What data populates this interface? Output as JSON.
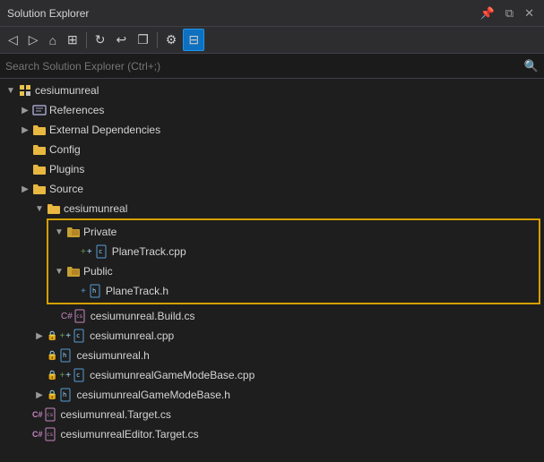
{
  "titleBar": {
    "title": "Solution Explorer",
    "icons": [
      "pin",
      "close-float",
      "close"
    ]
  },
  "toolbar": {
    "buttons": [
      {
        "name": "back",
        "label": "◀",
        "active": false
      },
      {
        "name": "forward",
        "label": "▶",
        "active": false
      },
      {
        "name": "home",
        "label": "⌂",
        "active": false
      },
      {
        "name": "properties",
        "label": "⊞",
        "active": false
      },
      {
        "name": "refresh",
        "label": "↺",
        "active": false
      },
      {
        "name": "back2",
        "label": "↩",
        "active": false
      },
      {
        "name": "copy",
        "label": "❐",
        "active": false
      },
      {
        "name": "settings",
        "label": "⚙",
        "active": false
      },
      {
        "name": "pin-active",
        "label": "⊟",
        "active": true
      }
    ]
  },
  "search": {
    "placeholder": "Search Solution Explorer (Ctrl+;)",
    "value": ""
  },
  "tree": {
    "items": [
      {
        "id": "cesiumunreal-root",
        "level": 0,
        "expand": "expanded",
        "icon": "project",
        "label": "cesiumunreal",
        "highlight": false
      },
      {
        "id": "references",
        "level": 1,
        "expand": "collapsed",
        "icon": "references",
        "label": "References",
        "highlight": false
      },
      {
        "id": "external-deps",
        "level": 1,
        "expand": "collapsed",
        "icon": "folder",
        "label": "External Dependencies",
        "highlight": false
      },
      {
        "id": "config",
        "level": 1,
        "expand": "none",
        "icon": "folder",
        "label": "Config",
        "highlight": false
      },
      {
        "id": "plugins",
        "level": 1,
        "expand": "none",
        "icon": "folder",
        "label": "Plugins",
        "highlight": false
      },
      {
        "id": "source",
        "level": 1,
        "expand": "collapsed",
        "icon": "folder",
        "label": "Source",
        "highlight": false
      },
      {
        "id": "cesiumunreal-inner",
        "level": 2,
        "expand": "expanded",
        "icon": "folder",
        "label": "cesiumunreal",
        "highlight": false
      },
      {
        "id": "private",
        "level": 3,
        "expand": "expanded",
        "icon": "folder2",
        "label": "Private",
        "highlight": true,
        "highlight-start": true
      },
      {
        "id": "planetrack-cpp",
        "level": 4,
        "expand": "none",
        "icon": "cpp",
        "label": "PlaneTrack.cpp",
        "highlight": true
      },
      {
        "id": "public",
        "level": 3,
        "expand": "expanded",
        "icon": "folder2",
        "label": "Public",
        "highlight": true
      },
      {
        "id": "planetrack-h",
        "level": 4,
        "expand": "none",
        "icon": "h",
        "label": "PlaneTrack.h",
        "highlight": true,
        "highlight-end": true
      },
      {
        "id": "build-cs",
        "level": 3,
        "expand": "none",
        "icon": "cs",
        "label": "cesiumunreal.Build.cs",
        "highlight": false
      },
      {
        "id": "cesiumunreal-cpp",
        "level": 2,
        "expand": "collapsed",
        "icon": "cpp",
        "label": "cesiumunreal.cpp",
        "highlight": false
      },
      {
        "id": "cesiumunreal-h",
        "level": 2,
        "expand": "none",
        "icon": "h",
        "label": "cesiumunreal.h",
        "highlight": false
      },
      {
        "id": "gamemode-cpp",
        "level": 2,
        "expand": "none",
        "icon": "cpp",
        "label": "cesiumunrealGameModeBase.cpp",
        "highlight": false
      },
      {
        "id": "gamemode-h",
        "level": 2,
        "expand": "collapsed",
        "icon": "h",
        "label": "cesiumunrealGameModeBase.h",
        "highlight": false
      },
      {
        "id": "target-cs",
        "level": 1,
        "expand": "none",
        "icon": "cs-target",
        "label": "cesiumunreal.Target.cs",
        "highlight": false
      },
      {
        "id": "editor-target-cs",
        "level": 1,
        "expand": "none",
        "icon": "cs-target",
        "label": "cesiumunrealEditor.Target.cs",
        "highlight": false
      }
    ]
  },
  "colors": {
    "highlight_border": "#d4a000",
    "selected_bg": "#094771",
    "hover_bg": "#2a2d2e",
    "toolbar_active": "#0e70c0"
  }
}
